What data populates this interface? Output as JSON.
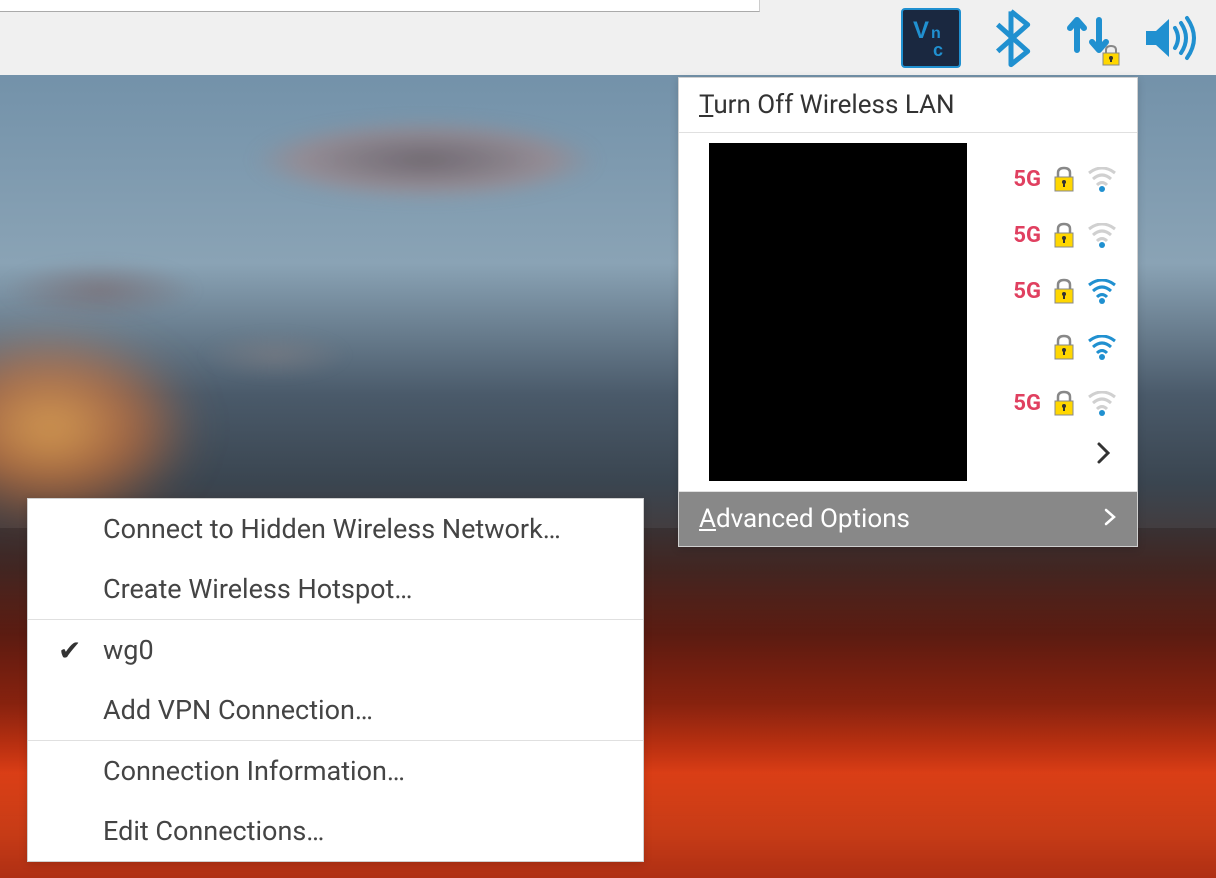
{
  "tray": {
    "icons": {
      "vnc": "vnc-icon",
      "bluetooth": "bluetooth-icon",
      "network": "network-icon",
      "volume": "volume-icon"
    }
  },
  "network_menu": {
    "turn_off_label": "Turn Off Wireless LAN",
    "turn_off_underline_char": "T",
    "advanced_label": "Advanced Options",
    "advanced_underline_char": "A",
    "wifi_networks": [
      {
        "band": "5G",
        "secured": true,
        "signal_strength": 1
      },
      {
        "band": "5G",
        "secured": true,
        "signal_strength": 1
      },
      {
        "band": "5G",
        "secured": true,
        "signal_strength": 3
      },
      {
        "band": "",
        "secured": true,
        "signal_strength": 3
      },
      {
        "band": "5G",
        "secured": true,
        "signal_strength": 1
      }
    ]
  },
  "submenu": {
    "items": [
      {
        "label": "Connect to Hidden Wireless Network…",
        "checked": false,
        "separator_after": false
      },
      {
        "label": "Create Wireless Hotspot…",
        "checked": false,
        "separator_after": true
      },
      {
        "label": "wg0",
        "checked": true,
        "separator_after": false
      },
      {
        "label": "Add VPN Connection…",
        "checked": false,
        "separator_after": true
      },
      {
        "label": "Connection Information…",
        "checked": false,
        "separator_after": false
      },
      {
        "label": "Edit Connections…",
        "checked": false,
        "separator_after": false
      }
    ]
  }
}
